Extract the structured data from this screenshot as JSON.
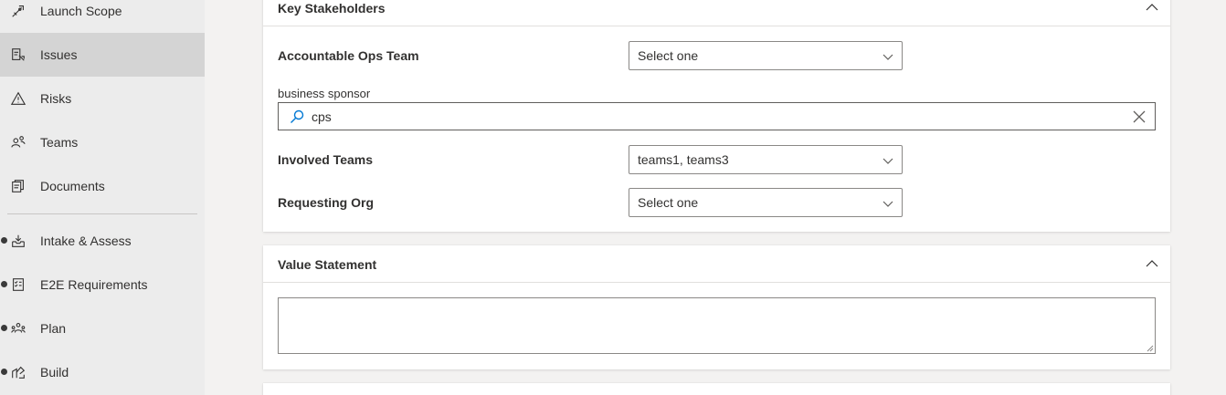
{
  "sidebar": {
    "items": [
      {
        "label": "Launch Scope",
        "icon": "rocket-icon"
      },
      {
        "label": "Issues",
        "icon": "issues-icon",
        "selected": true
      },
      {
        "label": "Risks",
        "icon": "warning-icon"
      },
      {
        "label": "Teams",
        "icon": "people-icon"
      },
      {
        "label": "Documents",
        "icon": "documents-icon"
      },
      {
        "label": "Intake & Assess",
        "icon": "inbox-icon"
      },
      {
        "label": "E2E Requirements",
        "icon": "checklist-icon"
      },
      {
        "label": "Plan",
        "icon": "plan-icon"
      },
      {
        "label": "Build",
        "icon": "build-icon"
      }
    ]
  },
  "key_stakeholders": {
    "title": "Key Stakeholders",
    "accountable_ops_team": {
      "label": "Accountable Ops Team",
      "value": "Select one"
    },
    "business_sponsor": {
      "label": "business sponsor",
      "value": "cps"
    },
    "involved_teams": {
      "label": "Involved Teams",
      "value": "teams1, teams3"
    },
    "requesting_org": {
      "label": "Requesting Org",
      "value": "Select one"
    }
  },
  "value_statement": {
    "title": "Value Statement",
    "value": ""
  },
  "colors": {
    "sidebar_bg": "#ececec",
    "selected_bg": "#d4d4d4",
    "search_icon": "#0078d4"
  }
}
